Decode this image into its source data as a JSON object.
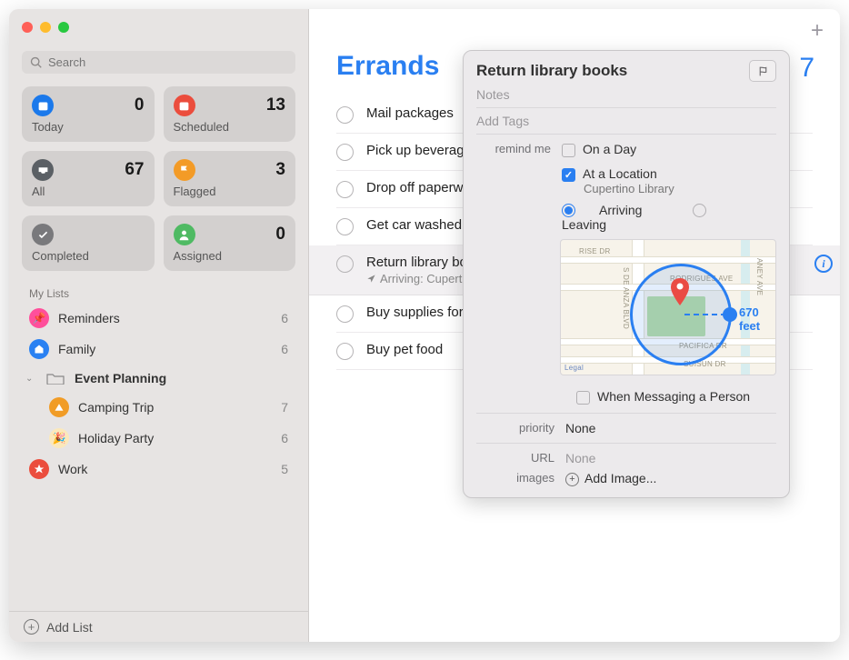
{
  "search": {
    "placeholder": "Search"
  },
  "cards": {
    "today": {
      "label": "Today",
      "count": "0"
    },
    "scheduled": {
      "label": "Scheduled",
      "count": "13"
    },
    "all": {
      "label": "All",
      "count": "67"
    },
    "flagged": {
      "label": "Flagged",
      "count": "3"
    },
    "completed": {
      "label": "Completed",
      "count": ""
    },
    "assigned": {
      "label": "Assigned",
      "count": "0"
    }
  },
  "sidebar": {
    "section": "My Lists",
    "lists": {
      "reminders": {
        "label": "Reminders",
        "count": "6"
      },
      "family": {
        "label": "Family",
        "count": "6"
      },
      "eventplan": {
        "label": "Event Planning",
        "count": ""
      },
      "camping": {
        "label": "Camping Trip",
        "count": "7"
      },
      "holiday": {
        "label": "Holiday Party",
        "count": "6"
      },
      "work": {
        "label": "Work",
        "count": "5"
      }
    },
    "addList": "Add List"
  },
  "main": {
    "title": "Errands",
    "count": "7",
    "items": [
      {
        "title": "Mail packages"
      },
      {
        "title": "Pick up beverages"
      },
      {
        "title": "Drop off paperwork"
      },
      {
        "title": "Get car washed"
      },
      {
        "title": "Return library books",
        "sub": "Arriving: Cupertino Library"
      },
      {
        "title": "Buy supplies for camping trip"
      },
      {
        "title": "Buy pet food"
      }
    ]
  },
  "detail": {
    "title": "Return library books",
    "notesPlaceholder": "Notes",
    "tagsPlaceholder": "Add Tags",
    "remindLabel": "remind me",
    "onDay": "On a Day",
    "atLocation": "At a Location",
    "locationName": "Cupertino Library",
    "arriving": "Arriving",
    "leaving": "Leaving",
    "radius": "670 feet",
    "mapLabels": {
      "rise": "RISE DR",
      "deanza": "S DE ANZA BLVD",
      "rodrigues": "RODRIGUES AVE",
      "aney": "ANEY AVE",
      "pacifica": "PACIFICA DR",
      "suisun": "SUISUN DR",
      "legal": "Legal"
    },
    "whenMessaging": "When Messaging a Person",
    "priorityLabel": "priority",
    "priorityValue": "None",
    "urlLabel": "URL",
    "urlValue": "None",
    "imagesLabel": "images",
    "addImage": "Add Image..."
  }
}
